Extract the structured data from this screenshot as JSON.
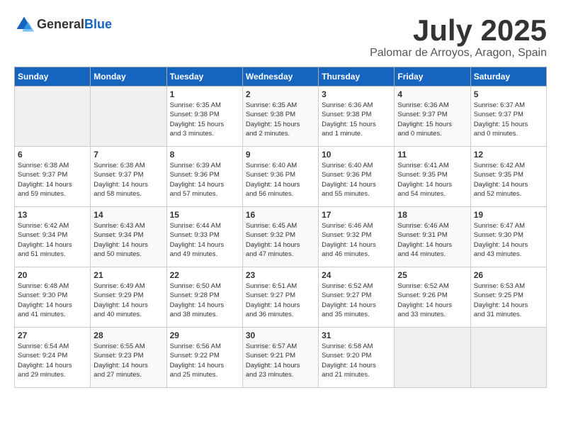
{
  "header": {
    "logo_general": "General",
    "logo_blue": "Blue",
    "month": "July 2025",
    "location": "Palomar de Arroyos, Aragon, Spain"
  },
  "days_of_week": [
    "Sunday",
    "Monday",
    "Tuesday",
    "Wednesday",
    "Thursday",
    "Friday",
    "Saturday"
  ],
  "weeks": [
    [
      {
        "day": "",
        "info": ""
      },
      {
        "day": "",
        "info": ""
      },
      {
        "day": "1",
        "info": "Sunrise: 6:35 AM\nSunset: 9:38 PM\nDaylight: 15 hours\nand 3 minutes."
      },
      {
        "day": "2",
        "info": "Sunrise: 6:35 AM\nSunset: 9:38 PM\nDaylight: 15 hours\nand 2 minutes."
      },
      {
        "day": "3",
        "info": "Sunrise: 6:36 AM\nSunset: 9:38 PM\nDaylight: 15 hours\nand 1 minute."
      },
      {
        "day": "4",
        "info": "Sunrise: 6:36 AM\nSunset: 9:37 PM\nDaylight: 15 hours\nand 0 minutes."
      },
      {
        "day": "5",
        "info": "Sunrise: 6:37 AM\nSunset: 9:37 PM\nDaylight: 15 hours\nand 0 minutes."
      }
    ],
    [
      {
        "day": "6",
        "info": "Sunrise: 6:38 AM\nSunset: 9:37 PM\nDaylight: 14 hours\nand 59 minutes."
      },
      {
        "day": "7",
        "info": "Sunrise: 6:38 AM\nSunset: 9:37 PM\nDaylight: 14 hours\nand 58 minutes."
      },
      {
        "day": "8",
        "info": "Sunrise: 6:39 AM\nSunset: 9:36 PM\nDaylight: 14 hours\nand 57 minutes."
      },
      {
        "day": "9",
        "info": "Sunrise: 6:40 AM\nSunset: 9:36 PM\nDaylight: 14 hours\nand 56 minutes."
      },
      {
        "day": "10",
        "info": "Sunrise: 6:40 AM\nSunset: 9:36 PM\nDaylight: 14 hours\nand 55 minutes."
      },
      {
        "day": "11",
        "info": "Sunrise: 6:41 AM\nSunset: 9:35 PM\nDaylight: 14 hours\nand 54 minutes."
      },
      {
        "day": "12",
        "info": "Sunrise: 6:42 AM\nSunset: 9:35 PM\nDaylight: 14 hours\nand 52 minutes."
      }
    ],
    [
      {
        "day": "13",
        "info": "Sunrise: 6:42 AM\nSunset: 9:34 PM\nDaylight: 14 hours\nand 51 minutes."
      },
      {
        "day": "14",
        "info": "Sunrise: 6:43 AM\nSunset: 9:34 PM\nDaylight: 14 hours\nand 50 minutes."
      },
      {
        "day": "15",
        "info": "Sunrise: 6:44 AM\nSunset: 9:33 PM\nDaylight: 14 hours\nand 49 minutes."
      },
      {
        "day": "16",
        "info": "Sunrise: 6:45 AM\nSunset: 9:32 PM\nDaylight: 14 hours\nand 47 minutes."
      },
      {
        "day": "17",
        "info": "Sunrise: 6:46 AM\nSunset: 9:32 PM\nDaylight: 14 hours\nand 46 minutes."
      },
      {
        "day": "18",
        "info": "Sunrise: 6:46 AM\nSunset: 9:31 PM\nDaylight: 14 hours\nand 44 minutes."
      },
      {
        "day": "19",
        "info": "Sunrise: 6:47 AM\nSunset: 9:30 PM\nDaylight: 14 hours\nand 43 minutes."
      }
    ],
    [
      {
        "day": "20",
        "info": "Sunrise: 6:48 AM\nSunset: 9:30 PM\nDaylight: 14 hours\nand 41 minutes."
      },
      {
        "day": "21",
        "info": "Sunrise: 6:49 AM\nSunset: 9:29 PM\nDaylight: 14 hours\nand 40 minutes."
      },
      {
        "day": "22",
        "info": "Sunrise: 6:50 AM\nSunset: 9:28 PM\nDaylight: 14 hours\nand 38 minutes."
      },
      {
        "day": "23",
        "info": "Sunrise: 6:51 AM\nSunset: 9:27 PM\nDaylight: 14 hours\nand 36 minutes."
      },
      {
        "day": "24",
        "info": "Sunrise: 6:52 AM\nSunset: 9:27 PM\nDaylight: 14 hours\nand 35 minutes."
      },
      {
        "day": "25",
        "info": "Sunrise: 6:52 AM\nSunset: 9:26 PM\nDaylight: 14 hours\nand 33 minutes."
      },
      {
        "day": "26",
        "info": "Sunrise: 6:53 AM\nSunset: 9:25 PM\nDaylight: 14 hours\nand 31 minutes."
      }
    ],
    [
      {
        "day": "27",
        "info": "Sunrise: 6:54 AM\nSunset: 9:24 PM\nDaylight: 14 hours\nand 29 minutes."
      },
      {
        "day": "28",
        "info": "Sunrise: 6:55 AM\nSunset: 9:23 PM\nDaylight: 14 hours\nand 27 minutes."
      },
      {
        "day": "29",
        "info": "Sunrise: 6:56 AM\nSunset: 9:22 PM\nDaylight: 14 hours\nand 25 minutes."
      },
      {
        "day": "30",
        "info": "Sunrise: 6:57 AM\nSunset: 9:21 PM\nDaylight: 14 hours\nand 23 minutes."
      },
      {
        "day": "31",
        "info": "Sunrise: 6:58 AM\nSunset: 9:20 PM\nDaylight: 14 hours\nand 21 minutes."
      },
      {
        "day": "",
        "info": ""
      },
      {
        "day": "",
        "info": ""
      }
    ]
  ]
}
